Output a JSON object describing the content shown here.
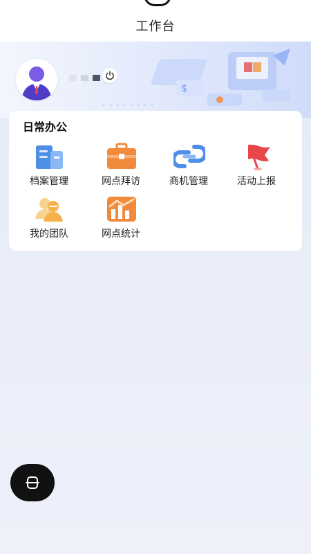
{
  "header": {
    "title": "工作台"
  },
  "user": {
    "name_dot_colors": [
      "#dfe3ea",
      "#cfd5de",
      "#4b5563"
    ]
  },
  "daily_office": {
    "title": "日常办公",
    "items": [
      {
        "label": "档案管理",
        "icon": "folder-building-icon"
      },
      {
        "label": "网点拜访",
        "icon": "briefcase-icon"
      },
      {
        "label": "商机管理",
        "icon": "link-icon"
      },
      {
        "label": "活动上报",
        "icon": "flag-icon"
      },
      {
        "label": "我的团队",
        "icon": "team-icon"
      },
      {
        "label": "网点统计",
        "icon": "statistics-chart-icon"
      }
    ]
  },
  "colors": {
    "blue": "#4f8fe8",
    "orange": "#f28a3c",
    "red": "#e8474a",
    "yellow": "#f6b24a"
  }
}
